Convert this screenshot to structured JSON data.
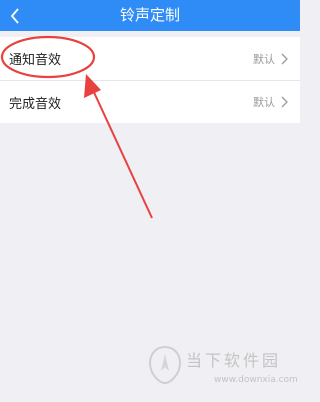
{
  "header": {
    "title": "铃声定制",
    "back_icon": "chevron-left-icon"
  },
  "settings": [
    {
      "label": "通知音效",
      "value": "默认"
    },
    {
      "label": "完成音效",
      "value": "默认"
    }
  ],
  "watermark": {
    "name": "当下软件园",
    "url": "www.downxia.com"
  },
  "colors": {
    "header_bg": "#2f8cf7",
    "annotation": "#e8413f",
    "background": "#efeff4"
  }
}
